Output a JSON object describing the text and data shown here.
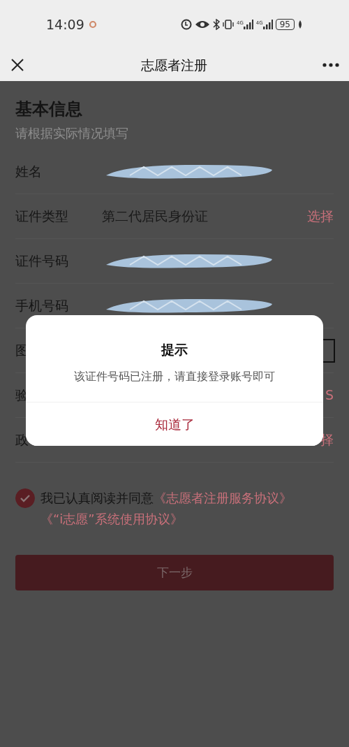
{
  "status_bar": {
    "time": "14:09",
    "network_labels": [
      "4G",
      "4G"
    ],
    "battery": "95"
  },
  "nav": {
    "title": "志愿者注册"
  },
  "form": {
    "title": "基本信息",
    "subtitle": "请根据实际情况填写",
    "rows": [
      {
        "kind": "text",
        "label": "姓名",
        "redacted": true
      },
      {
        "kind": "select",
        "label": "证件类型",
        "value": "第二代居民身份证",
        "action": "选择"
      },
      {
        "kind": "text",
        "label": "证件号码",
        "redacted": true
      },
      {
        "kind": "text",
        "label": "手机号码",
        "redacted": true
      },
      {
        "kind": "captcha",
        "label": "图"
      },
      {
        "kind": "sms",
        "label": "验",
        "action": "S"
      },
      {
        "kind": "select",
        "label": "政",
        "action": "择"
      }
    ]
  },
  "agreement": {
    "checked": true,
    "text": "我已认真阅读并同意",
    "links": [
      "《志愿者注册服务协议》",
      "《“i志愿”系统使用协议》"
    ]
  },
  "next_button": {
    "label": "下一步",
    "disabled": true
  },
  "dialog": {
    "title": "提示",
    "message": "该证件号码已注册，请直接登录账号即可",
    "button": "知道了"
  }
}
